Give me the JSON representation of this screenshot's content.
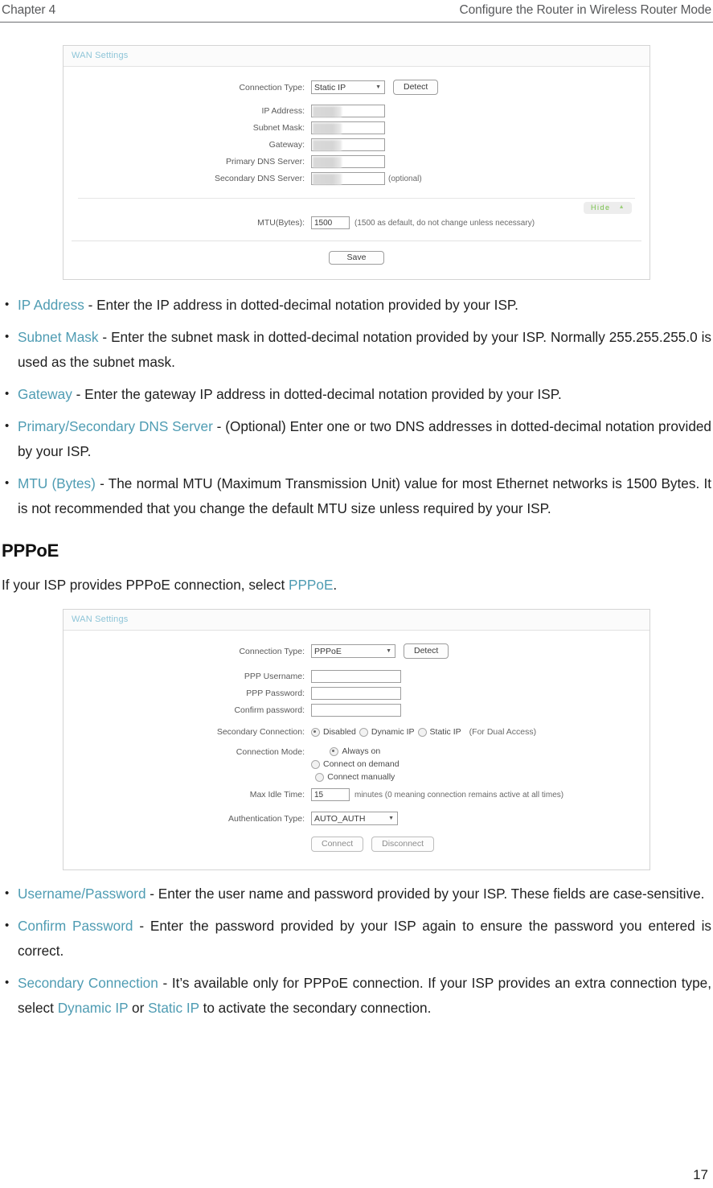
{
  "header": {
    "chapter": "Chapter 4",
    "title": "Configure the Router in Wireless Router Mode"
  },
  "panel_static": {
    "panel_title": "WAN Settings",
    "connection_type_label": "Connection Type:",
    "connection_type_value": "Static IP",
    "detect_button": "Detect",
    "ip_address_label": "IP Address:",
    "subnet_mask_label": "Subnet Mask:",
    "gateway_label": "Gateway:",
    "primary_dns_label": "Primary DNS Server:",
    "secondary_dns_label": "Secondary DNS Server:",
    "optional_note": "(optional)",
    "hide_label": "Hide",
    "mtu_label": "MTU(Bytes):",
    "mtu_value": "1500",
    "mtu_hint": "(1500 as default, do not change unless necessary)",
    "save_button": "Save"
  },
  "bullets_static": [
    {
      "term": "IP Address",
      "text": " - Enter the IP address in dotted-decimal notation provided by your ISP."
    },
    {
      "term": "Subnet Mask",
      "text": " - Enter the subnet mask in dotted-decimal notation provided by your ISP. Normally 255.255.255.0 is used as the subnet mask."
    },
    {
      "term": "Gateway",
      "text": " - Enter the gateway IP address in dotted-decimal notation provided by your ISP."
    },
    {
      "term": "Primary/Secondary DNS Server",
      "text": " - (Optional) Enter one or two DNS addresses in dotted-decimal notation provided by your ISP."
    },
    {
      "term": "MTU (Bytes)",
      "text": " - The normal MTU (Maximum Transmission Unit) value for most Ethernet networks is 1500 Bytes. It is not recommended that you change the default MTU size unless required by your ISP."
    }
  ],
  "section": {
    "heading": "PPPoE",
    "intro_before": "If your ISP provides PPPoE connection, select ",
    "intro_term": "PPPoE",
    "intro_after": "."
  },
  "panel_pppoe": {
    "panel_title": "WAN Settings",
    "connection_type_label": "Connection Type:",
    "connection_type_value": "PPPoE",
    "detect_button": "Detect",
    "ppp_username_label": "PPP Username:",
    "ppp_password_label": "PPP Password:",
    "confirm_password_label": "Confirm password:",
    "secondary_connection_label": "Secondary Connection:",
    "secondary_options": [
      "Disabled",
      "Dynamic IP",
      "Static IP"
    ],
    "secondary_note": "(For Dual Access)",
    "connection_mode_label": "Connection Mode:",
    "connection_modes": [
      "Always on",
      "Connect on demand",
      "Connect manually"
    ],
    "max_idle_label": "Max Idle Time:",
    "max_idle_value": "15",
    "max_idle_hint": "minutes (0 meaning connection remains active at all times)",
    "auth_type_label": "Authentication Type:",
    "auth_type_value": "AUTO_AUTH",
    "connect_button": "Connect",
    "disconnect_button": "Disconnect"
  },
  "bullets_pppoe": [
    {
      "term": "Username/Password",
      "text": " - Enter the user name and password provided by your ISP. These fields are case-sensitive."
    },
    {
      "term": "Confirm Password",
      "text": " - Enter the password provided by your ISP again to ensure the password you entered is correct."
    }
  ],
  "bullet_secondary": {
    "term": "Secondary Connection",
    "part1": " - It’s available only for PPPoE connection. If your ISP provides an extra connection type, select ",
    "link1": "Dynamic IP",
    "mid": " or ",
    "link2": "Static IP",
    "part2": " to activate the secondary connection."
  },
  "page_number": "17",
  "colors": {
    "term_blue": "#4f9cb3",
    "panel_title_blue": "#8ec5d8",
    "hide_green": "#77c14a"
  }
}
